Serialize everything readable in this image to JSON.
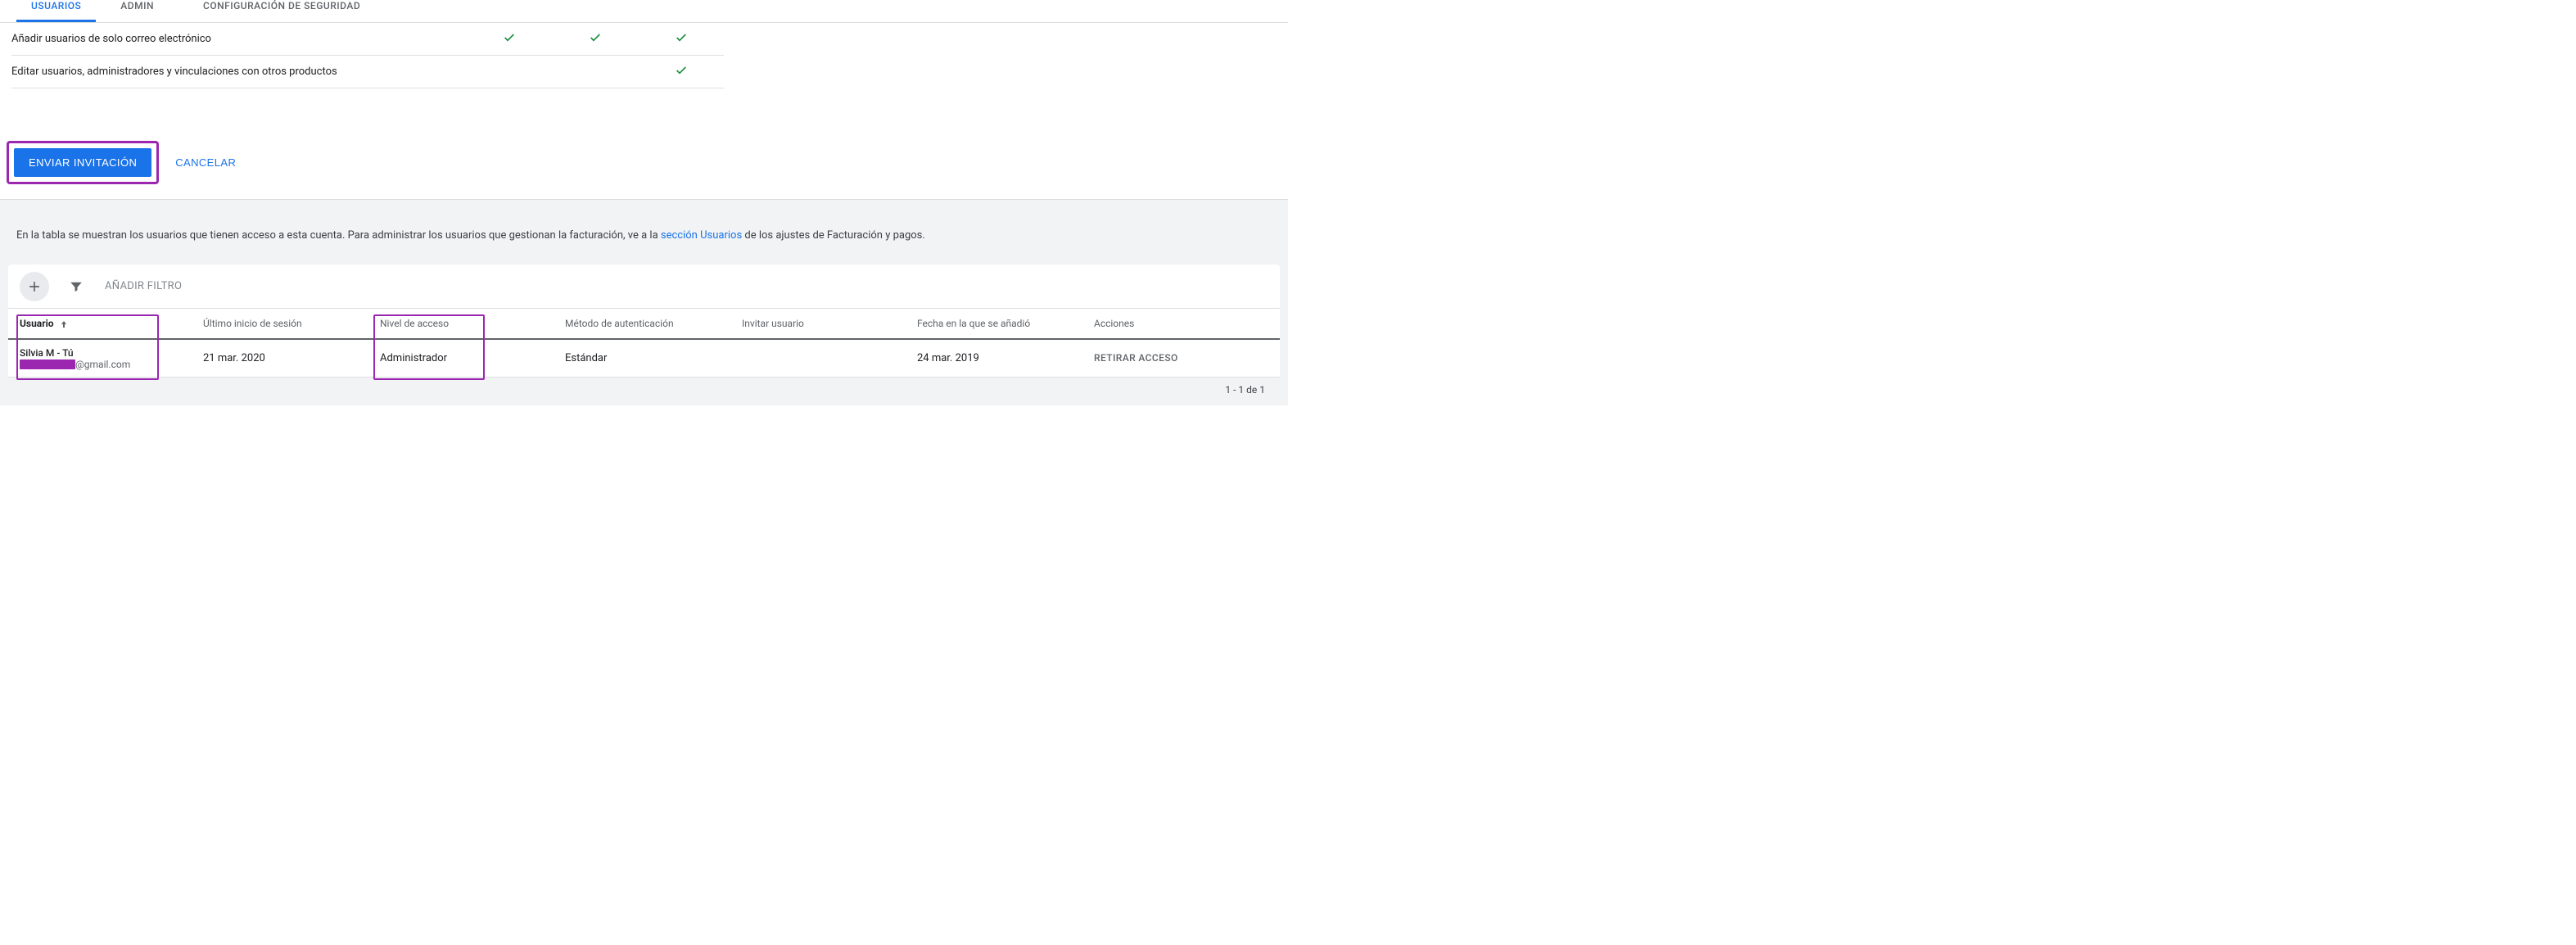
{
  "tabs": {
    "users": "USUARIOS",
    "admin": "ADMIN",
    "security": "CONFIGURACIÓN DE SEGURIDAD"
  },
  "permissions": {
    "row1": {
      "label": "Añadir usuarios de solo correo electrónico",
      "c0": true,
      "c1": true,
      "c2": true
    },
    "row2": {
      "label": "Editar usuarios, administradores y vinculaciones con otros productos",
      "c0": false,
      "c1": false,
      "c2": true
    }
  },
  "actions": {
    "send": "ENVIAR INVITACIÓN",
    "cancel": "CANCELAR"
  },
  "lower": {
    "desc_pre": "En la tabla se muestran los usuarios que tienen acceso a esta cuenta. Para administrar los usuarios que gestionan la facturación, ve a la ",
    "desc_link": "sección Usuarios",
    "desc_post": " de los ajustes de Facturación y pagos.",
    "add_filter": "AÑADIR FILTRO"
  },
  "table": {
    "headers": {
      "user": "Usuario",
      "last_login": "Último inicio de sesión",
      "access_level": "Nivel de acceso",
      "auth_method": "Método de autenticación",
      "invite_user": "Invitar usuario",
      "date_added": "Fecha en la que se añadió",
      "actions": "Acciones"
    },
    "rows": [
      {
        "name": "Silvia M - Tú",
        "email_suffix": "@gmail.com",
        "last_login": "21 mar. 2020",
        "access_level": "Administrador",
        "auth_method": "Estándar",
        "invite_user": "",
        "date_added": "24 mar. 2019",
        "action": "RETIRAR ACCESO"
      }
    ],
    "pager": "1 - 1 de 1"
  }
}
